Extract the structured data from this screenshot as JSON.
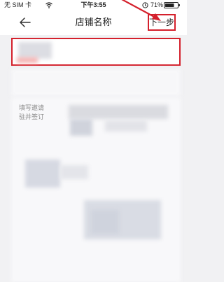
{
  "status_bar": {
    "carrier": "无 SIM 卡",
    "time": "下午3:55",
    "battery_percent": "71%"
  },
  "nav": {
    "title": "店铺名称",
    "next_label": "下一步"
  },
  "name_field": {
    "value": ""
  },
  "hint": {
    "line1": "填写邀请",
    "line2": "驻并签订"
  },
  "colors": {
    "annotation_red": "#d4202c",
    "hint_gray": "#8a8a8a",
    "page_bg": "#f1f1f3"
  },
  "icons": [
    "wifi-icon",
    "alarm-icon",
    "battery-icon",
    "back-arrow-icon"
  ]
}
